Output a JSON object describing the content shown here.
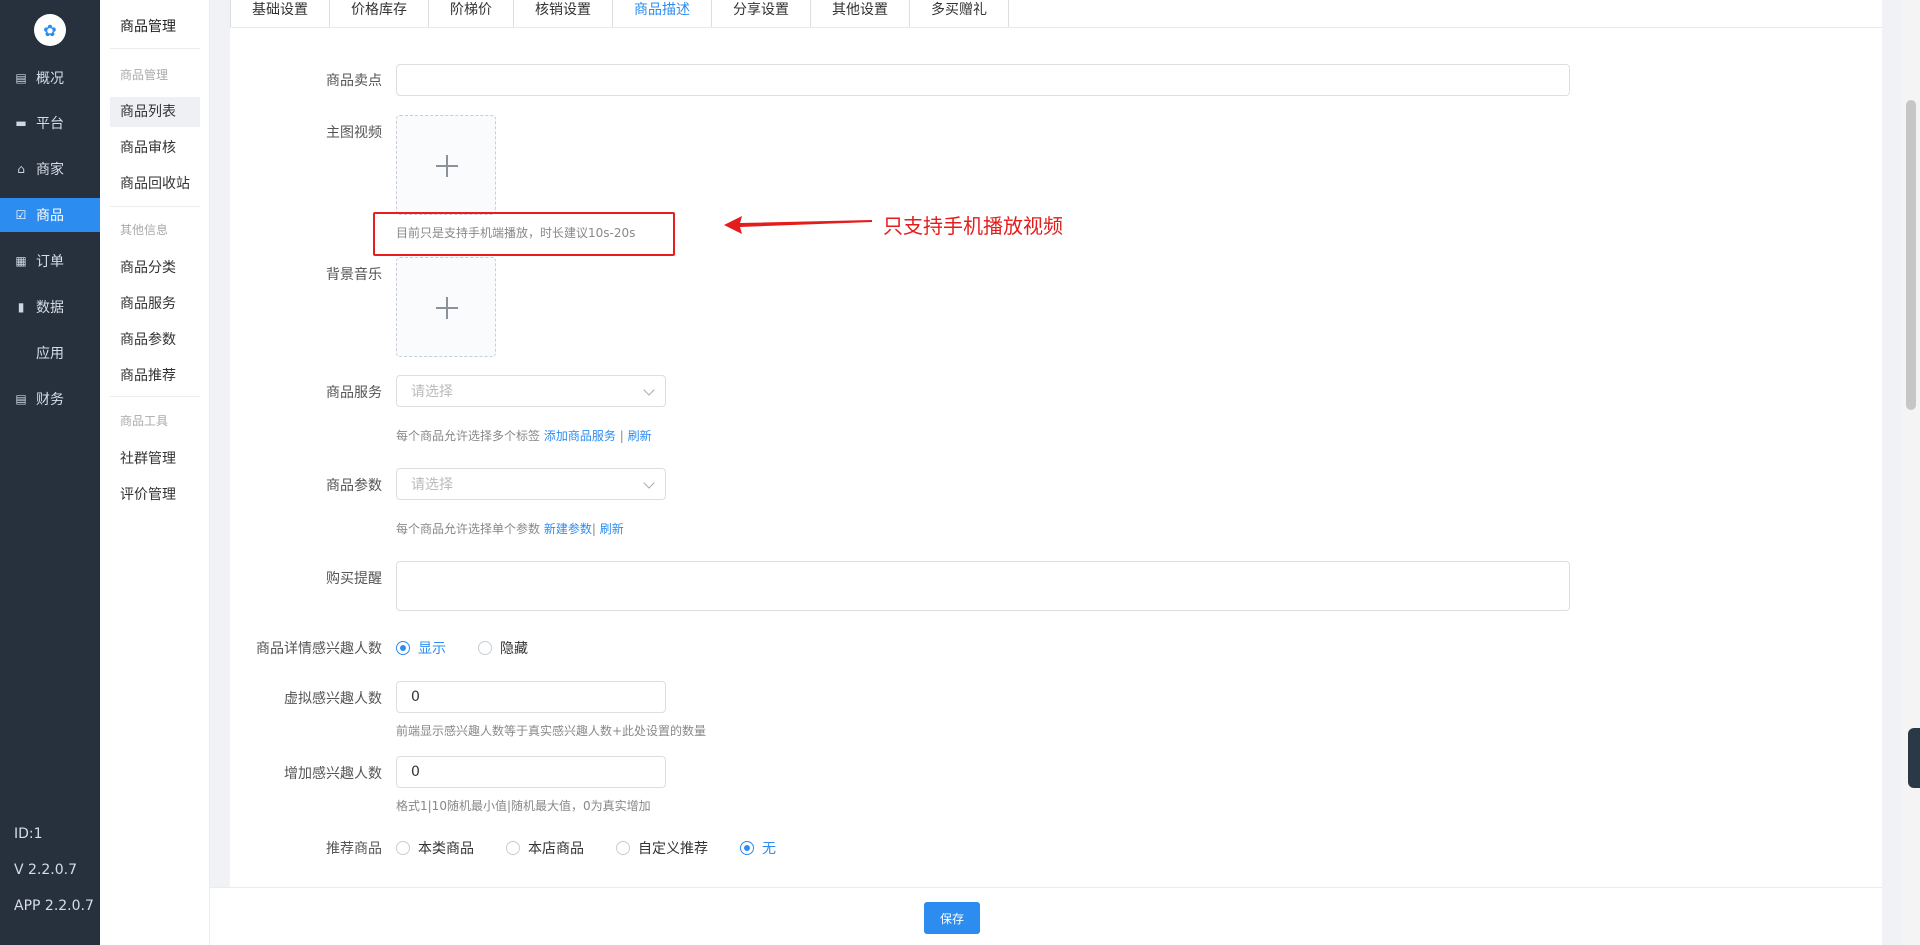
{
  "sidebar": {
    "logo_text": "",
    "items": [
      {
        "label": "概况",
        "icon": "chart-icon"
      },
      {
        "label": "平台",
        "icon": "monitor-icon"
      },
      {
        "label": "商家",
        "icon": "store-icon"
      },
      {
        "label": "商品",
        "icon": "goods-icon",
        "active": true
      },
      {
        "label": "订单",
        "icon": "order-icon"
      },
      {
        "label": "数据",
        "icon": "bar-chart-icon"
      },
      {
        "label": "应用",
        "icon": "apps-icon"
      },
      {
        "label": "财务",
        "icon": "finance-icon"
      }
    ],
    "id_text": "ID:1",
    "version": "V 2.2.0.7",
    "app_version": "APP 2.2.0.7"
  },
  "submenu": {
    "title": "商品管理",
    "group1": "商品管理",
    "items1": [
      "商品列表",
      "商品审核",
      "商品回收站"
    ],
    "group2": "其他信息",
    "items2": [
      "商品分类",
      "商品服务",
      "商品参数",
      "商品推荐"
    ],
    "group3": "商品工具",
    "items3": [
      "社群管理",
      "评价管理"
    ]
  },
  "tabs": [
    "基础设置",
    "价格库存",
    "阶梯价",
    "核销设置",
    "商品描述",
    "分享设置",
    "其他设置",
    "多买赠礼"
  ],
  "form": {
    "selling_point_label": "商品卖点",
    "main_video_label": "主图视频",
    "video_hint": "目前只是支持手机端播放，时长建议10s-20s",
    "bg_music_label": "背景音乐",
    "service_label": "商品服务",
    "service_placeholder": "请选择",
    "service_hint": "每个商品允许选择多个标签",
    "service_add_link": "添加商品服务",
    "service_sep": "|",
    "service_refresh": "刷新",
    "param_label": "商品参数",
    "param_placeholder": "请选择",
    "param_hint": "每个商品允许选择单个参数",
    "param_new_link": "新建参数",
    "param_sep": "|",
    "param_refresh": "刷新",
    "reminder_label": "购买提醒",
    "interest_show_label": "商品详情感兴趣人数",
    "interest_show_options": [
      "显示",
      "隐藏"
    ],
    "virtual_label": "虚拟感兴趣人数",
    "virtual_value": "0",
    "virtual_hint": "前端显示感兴趣人数等于真实感兴趣人数+此处设置的数量",
    "increase_label": "增加感兴趣人数",
    "increase_value": "0",
    "increase_hint": "格式1|10随机最小值|随机最大值，0为真实增加",
    "recommend_label": "推荐商品",
    "recommend_options": [
      "本类商品",
      "本店商品",
      "自定义推荐",
      "无"
    ]
  },
  "annotation": "只支持手机播放视频",
  "save_label": "保存",
  "colors": {
    "accent": "#2d8cf0",
    "sidebar": "#26313d",
    "annotation": "#e51c1c"
  }
}
